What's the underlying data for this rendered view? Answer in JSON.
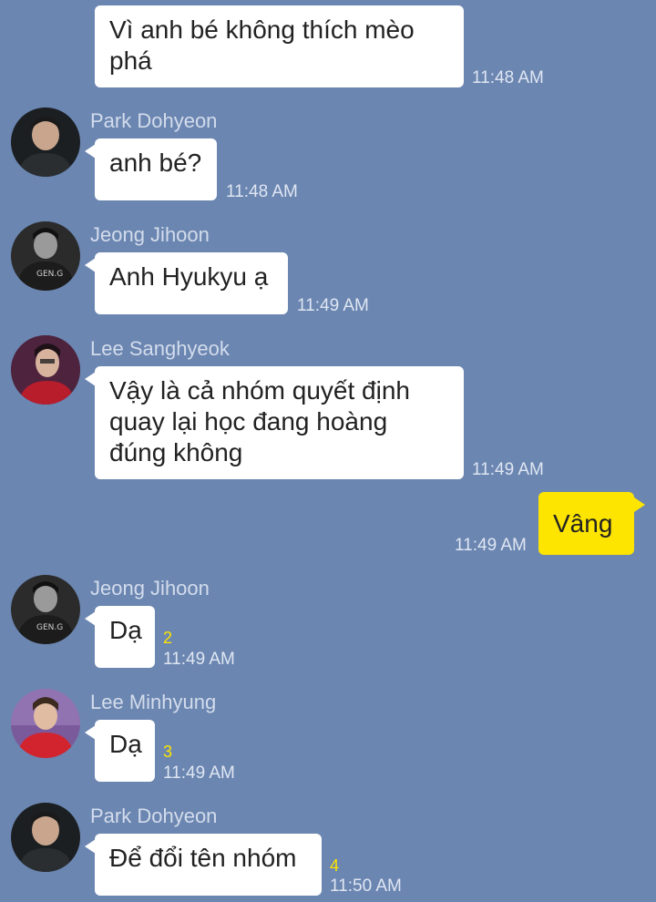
{
  "messages": [
    {
      "sender": "",
      "text_lines": [
        "Vì anh bé không thích mèo",
        "phá"
      ],
      "time": "11:48 AM"
    },
    {
      "sender": "Park Dohyeon",
      "text": "anh bé?",
      "time": "11:48 AM"
    },
    {
      "sender": "Jeong Jihoon",
      "text": "Anh Hyukyu ạ",
      "time": "11:49 AM"
    },
    {
      "sender": "Lee Sanghyeok",
      "text_lines": [
        "Vậy là cả nhóm quyết định",
        "quay lại học đang hoàng",
        "đúng không"
      ],
      "time": "11:49 AM"
    },
    {
      "sender": "me",
      "text": "Vâng",
      "time": "11:49 AM"
    },
    {
      "sender": "Jeong Jihoon",
      "text": "Dạ",
      "unread": "2",
      "time": "11:49 AM"
    },
    {
      "sender": "Lee Minhyung",
      "text": "Dạ",
      "unread": "3",
      "time": "11:49 AM"
    },
    {
      "sender": "Park Dohyeon",
      "text": "Để đổi tên nhóm",
      "unread": "4",
      "time": "11:50 AM"
    }
  ],
  "colors": {
    "background": "#6b86b1",
    "bubble": "#ffffff",
    "my_bubble": "#fee500",
    "unread": "#fee500"
  }
}
